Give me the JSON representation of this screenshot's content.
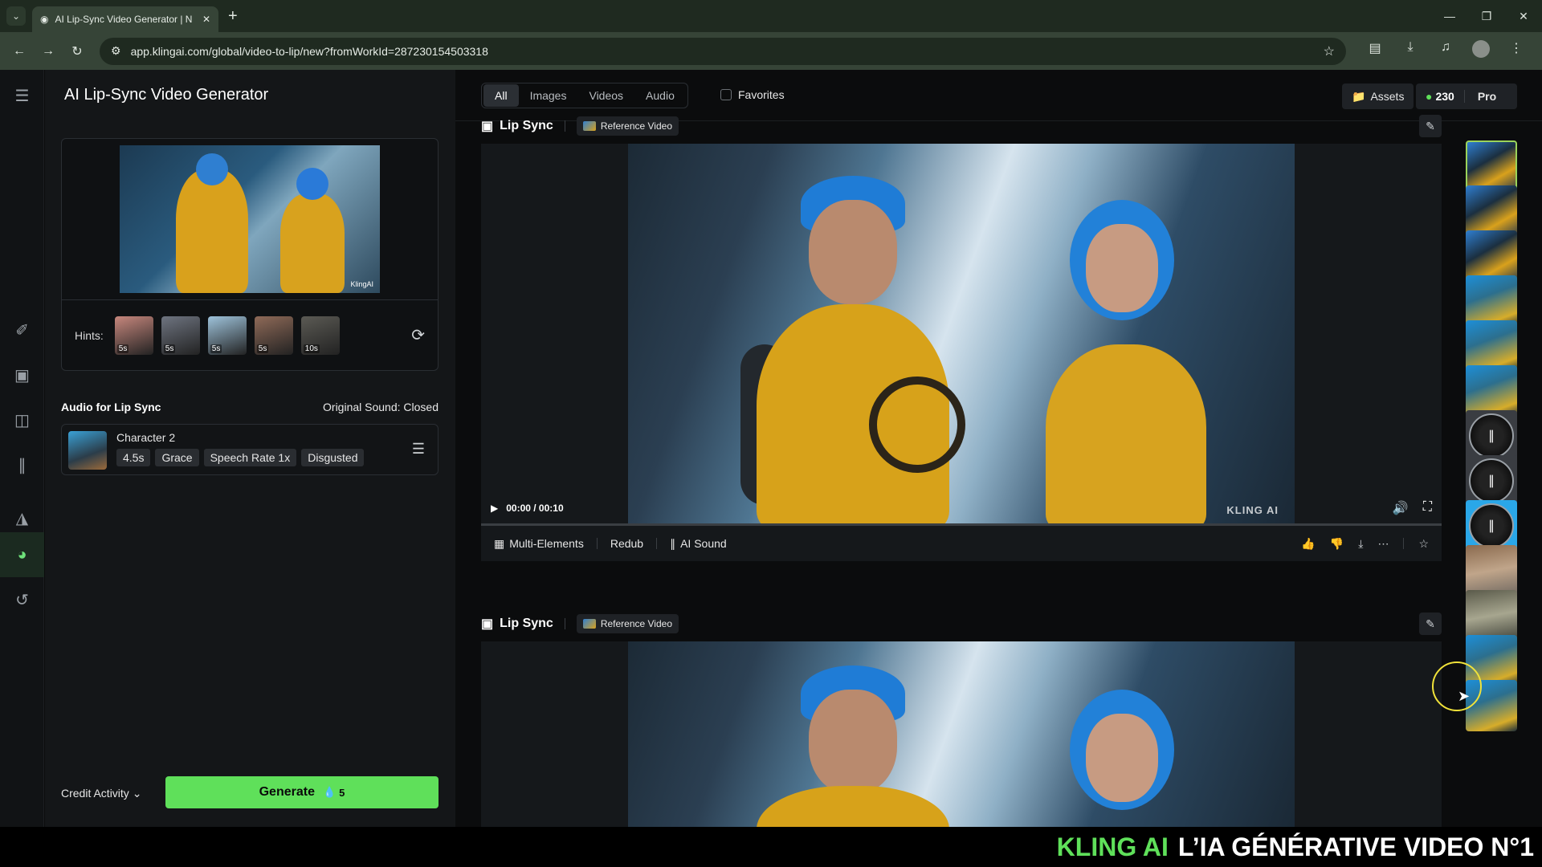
{
  "browser": {
    "tab_title": "AI Lip-Sync Video Generator | N",
    "url": "app.klingai.com/global/video-to-lip/new?fromWorkId=287230154503318"
  },
  "left_panel": {
    "title": "AI Lip-Sync Video Generator",
    "preview_watermark": "KlingAI",
    "hints_label": "Hints:",
    "hints": [
      {
        "duration": "5s",
        "color": "#c7877d"
      },
      {
        "duration": "5s",
        "color": "#6e7480"
      },
      {
        "duration": "5s",
        "color": "#9ec3db"
      },
      {
        "duration": "5s",
        "color": "#8f6a58"
      },
      {
        "duration": "10s",
        "color": "#5b5a54"
      }
    ],
    "audio_title": "Audio for Lip Sync",
    "original_sound": "Original Sound: Closed",
    "character": {
      "name": "Character 2",
      "chips": [
        "4.5s",
        "Grace",
        "Speech Rate 1x",
        "Disgusted"
      ]
    },
    "credit_activity": "Credit Activity",
    "generate_label": "Generate",
    "generate_cost": "5"
  },
  "topbar": {
    "filters": [
      "All",
      "Images",
      "Videos",
      "Audio"
    ],
    "active_filter": "All",
    "favorites_label": "Favorites",
    "assets_label": "Assets",
    "credits": "230",
    "plan": "Pro"
  },
  "works": [
    {
      "type_label": "Lip Sync",
      "ref_label": "Reference Video",
      "time": "00:00 / 00:10",
      "watermark": "KLING AI",
      "progress": 0,
      "actions": [
        "Multi-Elements",
        "Redub",
        "AI Sound"
      ]
    },
    {
      "type_label": "Lip Sync",
      "ref_label": "Reference Video"
    }
  ],
  "history_thumbs": [
    {
      "kind": "poster",
      "selected": true
    },
    {
      "kind": "poster"
    },
    {
      "kind": "poster"
    },
    {
      "kind": "woman"
    },
    {
      "kind": "woman"
    },
    {
      "kind": "woman"
    },
    {
      "kind": "audio"
    },
    {
      "kind": "audio"
    },
    {
      "kind": "audio-blue"
    },
    {
      "kind": "street"
    },
    {
      "kind": "park"
    },
    {
      "kind": "woman"
    },
    {
      "kind": "woman"
    }
  ],
  "banner": {
    "brand": "KLING AI",
    "tagline": "L’IA GÉNÉRATIVE VIDEO N°1"
  }
}
